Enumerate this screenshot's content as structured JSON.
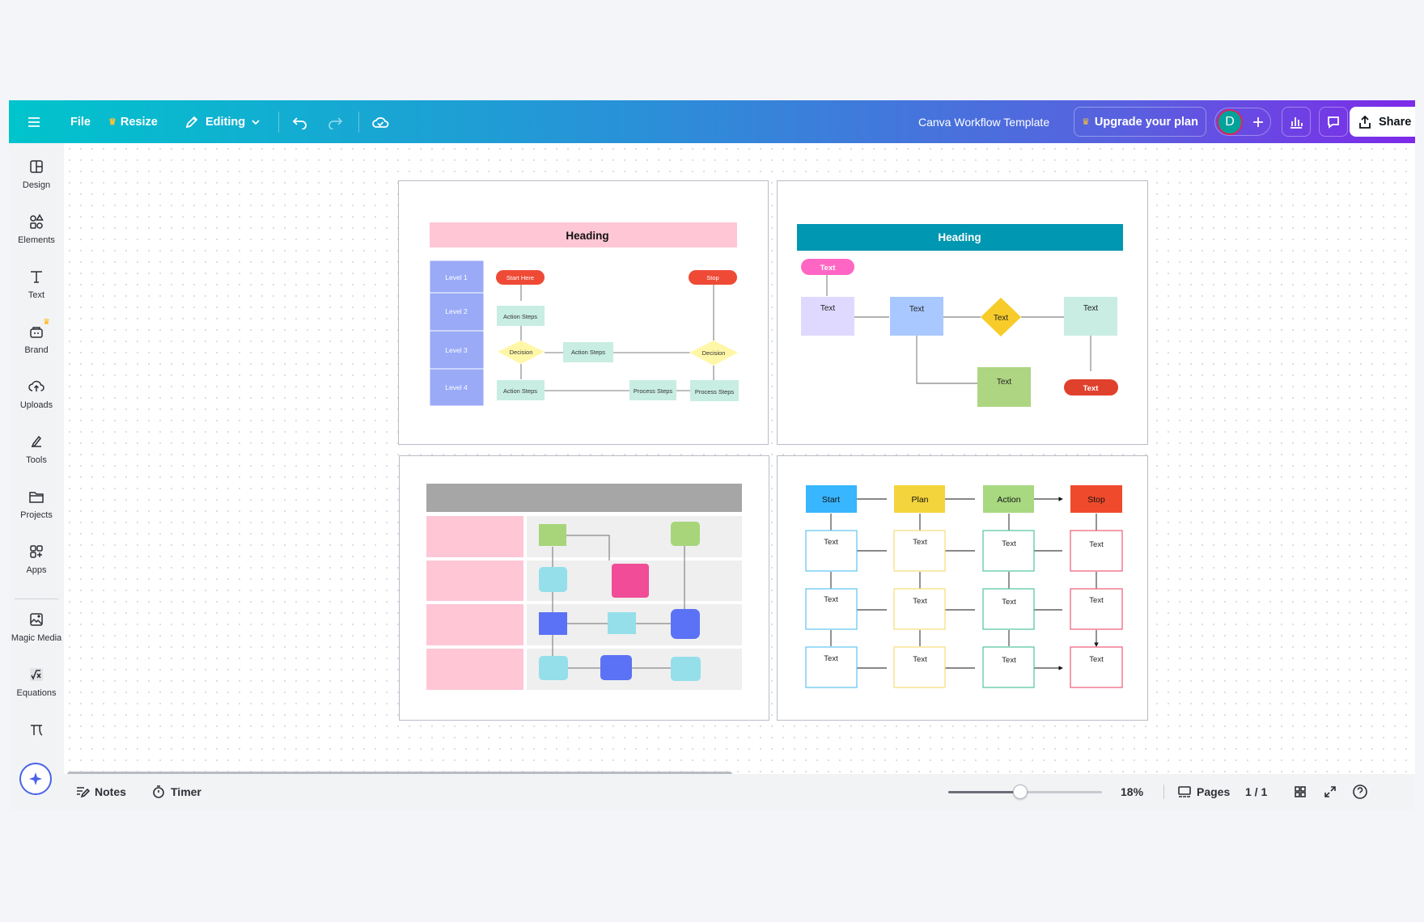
{
  "app": {
    "document_title": "Canva Workflow Template",
    "brand_gradient": [
      "#00c4cc",
      "#7d2ae8"
    ]
  },
  "topbar": {
    "menu_icon": "hamburger-icon",
    "file_label": "File",
    "resize_label": "Resize",
    "editing_label": "Editing",
    "upgrade_label": "Upgrade your plan",
    "avatar_initial": "D",
    "share_label": "Share"
  },
  "sidebar": {
    "items": [
      {
        "label": "Design",
        "icon": "design-icon"
      },
      {
        "label": "Elements",
        "icon": "elements-icon"
      },
      {
        "label": "Text",
        "icon": "text-icon"
      },
      {
        "label": "Brand",
        "icon": "brand-icon"
      },
      {
        "label": "Uploads",
        "icon": "uploads-icon"
      },
      {
        "label": "Tools",
        "icon": "tools-icon"
      },
      {
        "label": "Projects",
        "icon": "projects-icon"
      },
      {
        "label": "Apps",
        "icon": "apps-icon"
      },
      {
        "label": "Magic Media",
        "icon": "magic-media-icon"
      },
      {
        "label": "Equations",
        "icon": "equations-icon"
      }
    ]
  },
  "pages": {
    "p1": {
      "heading": "Heading",
      "levels": [
        "Level 1",
        "Level 2",
        "Level 3",
        "Level 4"
      ],
      "start": "Start Here",
      "stop": "Stop",
      "action": "Action Steps",
      "decision": "Decision",
      "process": "Process Steps"
    },
    "p2": {
      "heading": "Heading",
      "text": "Text"
    },
    "p4": {
      "headers": [
        "Start",
        "Plan",
        "Action",
        "Stop"
      ],
      "cell": "Text"
    }
  },
  "bottombar": {
    "notes_label": "Notes",
    "timer_label": "Timer",
    "zoom_level": "18%",
    "zoom_fraction": 0.47,
    "pages_label": "Pages",
    "page_count": "1 / 1"
  }
}
